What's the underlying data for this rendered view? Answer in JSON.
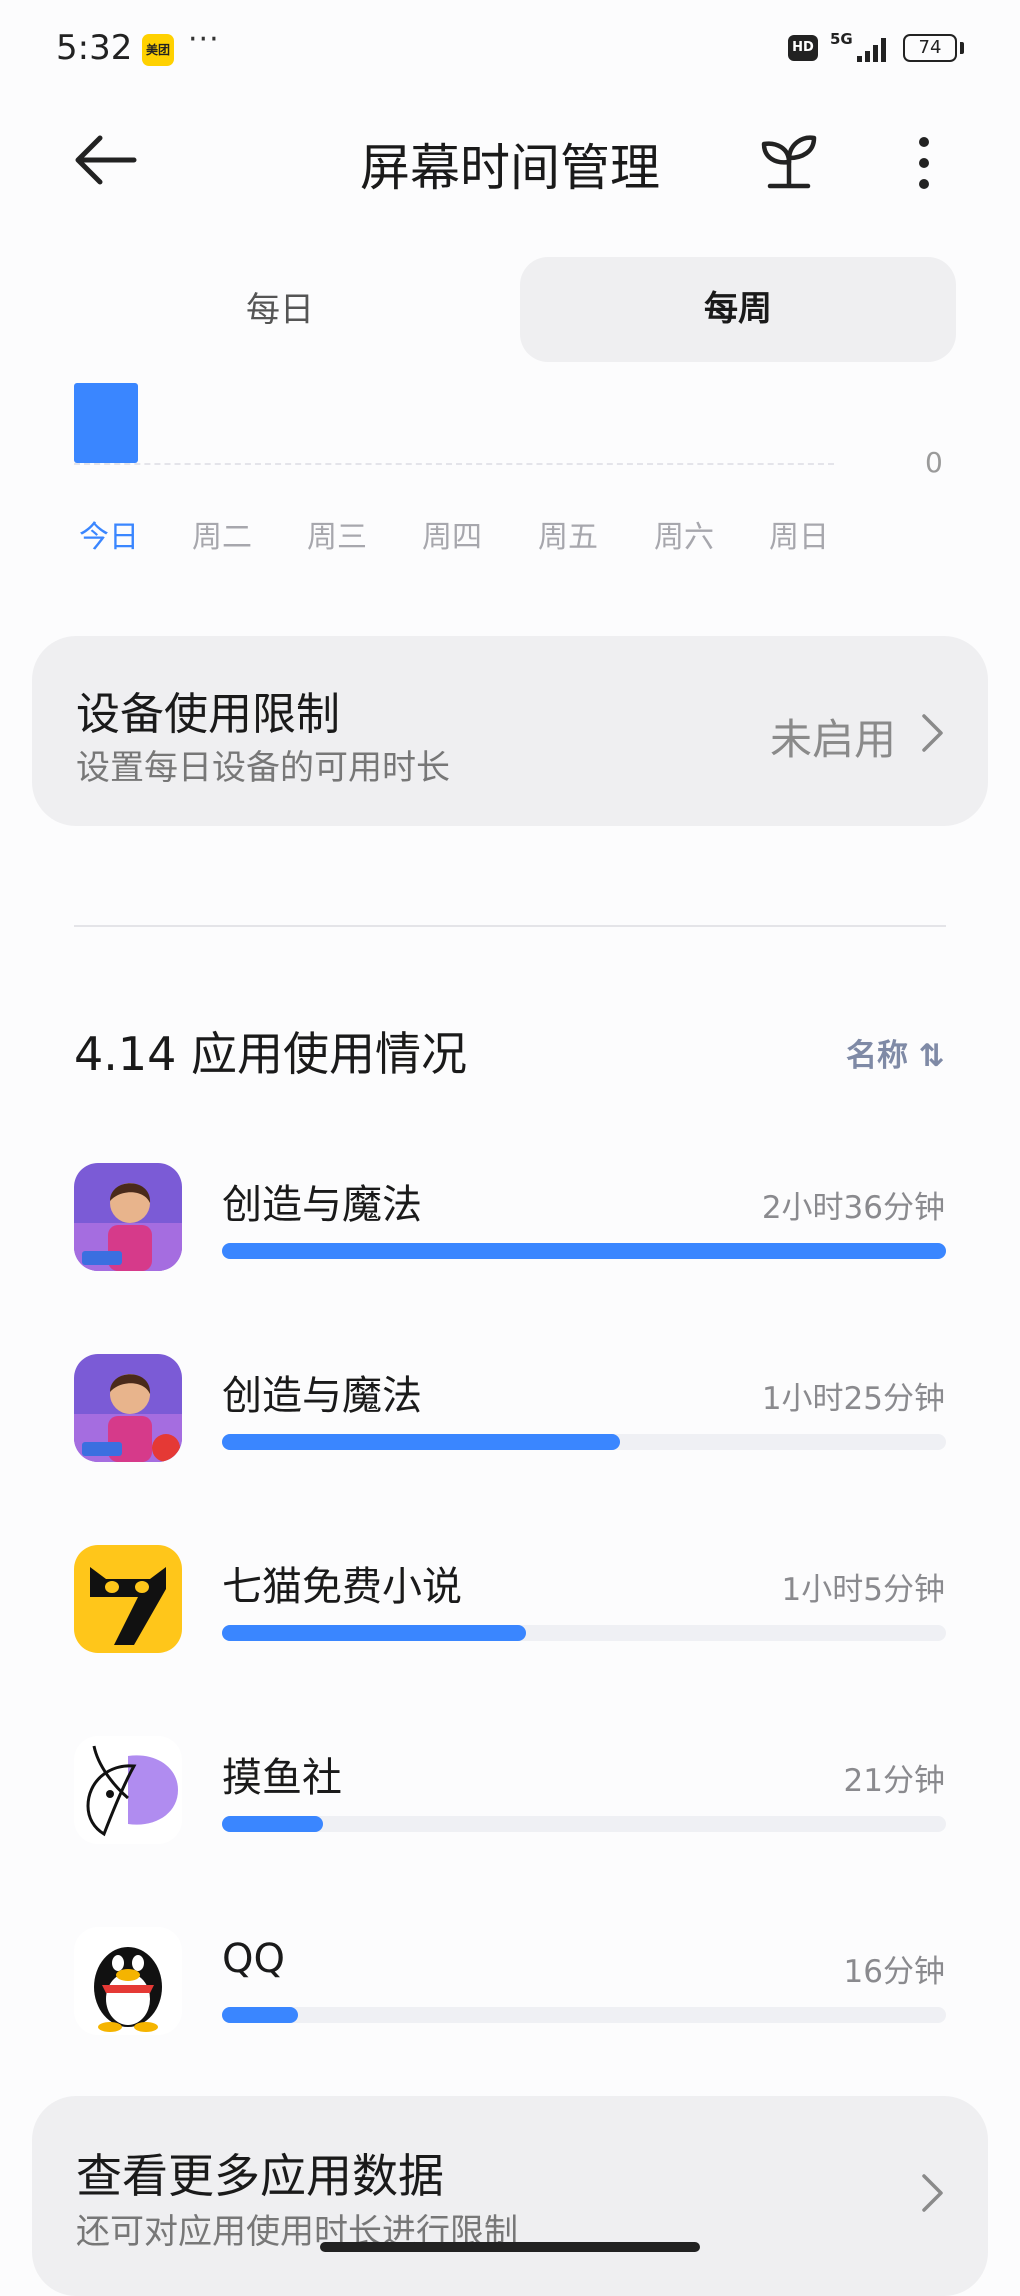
{
  "status_bar": {
    "time": "5:32",
    "app_badge": "美团",
    "more_dots": "···",
    "hd": "HD",
    "network": "5G",
    "battery": "74"
  },
  "header": {
    "title": "屏幕时间管理"
  },
  "tabs": {
    "daily": "每日",
    "weekly": "每周",
    "selected": "weekly"
  },
  "chart_data": {
    "type": "bar",
    "categories": [
      "今日",
      "周二",
      "周三",
      "周四",
      "周五",
      "周六",
      "周日"
    ],
    "y_tick": "0",
    "highlighted": "今日"
  },
  "device_limit": {
    "title": "设备使用限制",
    "subtitle": "设置每日设备的可用时长",
    "status": "未启用"
  },
  "usage": {
    "title": "4.14 应用使用情况",
    "sort_label": "名称 ⇅",
    "accent": "#3a86ff",
    "apps": [
      {
        "name": "创造与魔法",
        "time": "2小时36分钟",
        "fraction": 1.0,
        "icon": "game-character-icon"
      },
      {
        "name": "创造与魔法",
        "time": "1小时25分钟",
        "fraction": 0.55,
        "icon": "game-character-icon"
      },
      {
        "name": "七猫免费小说",
        "time": "1小时5分钟",
        "fraction": 0.42,
        "icon": "black-cat-icon"
      },
      {
        "name": "摸鱼社",
        "time": "21分钟",
        "fraction": 0.14,
        "icon": "fish-icon"
      },
      {
        "name": "QQ",
        "time": "16分钟",
        "fraction": 0.105,
        "icon": "penguin-icon"
      }
    ]
  },
  "more_data": {
    "title": "查看更多应用数据",
    "subtitle": "还可对应用使用时长进行限制"
  }
}
